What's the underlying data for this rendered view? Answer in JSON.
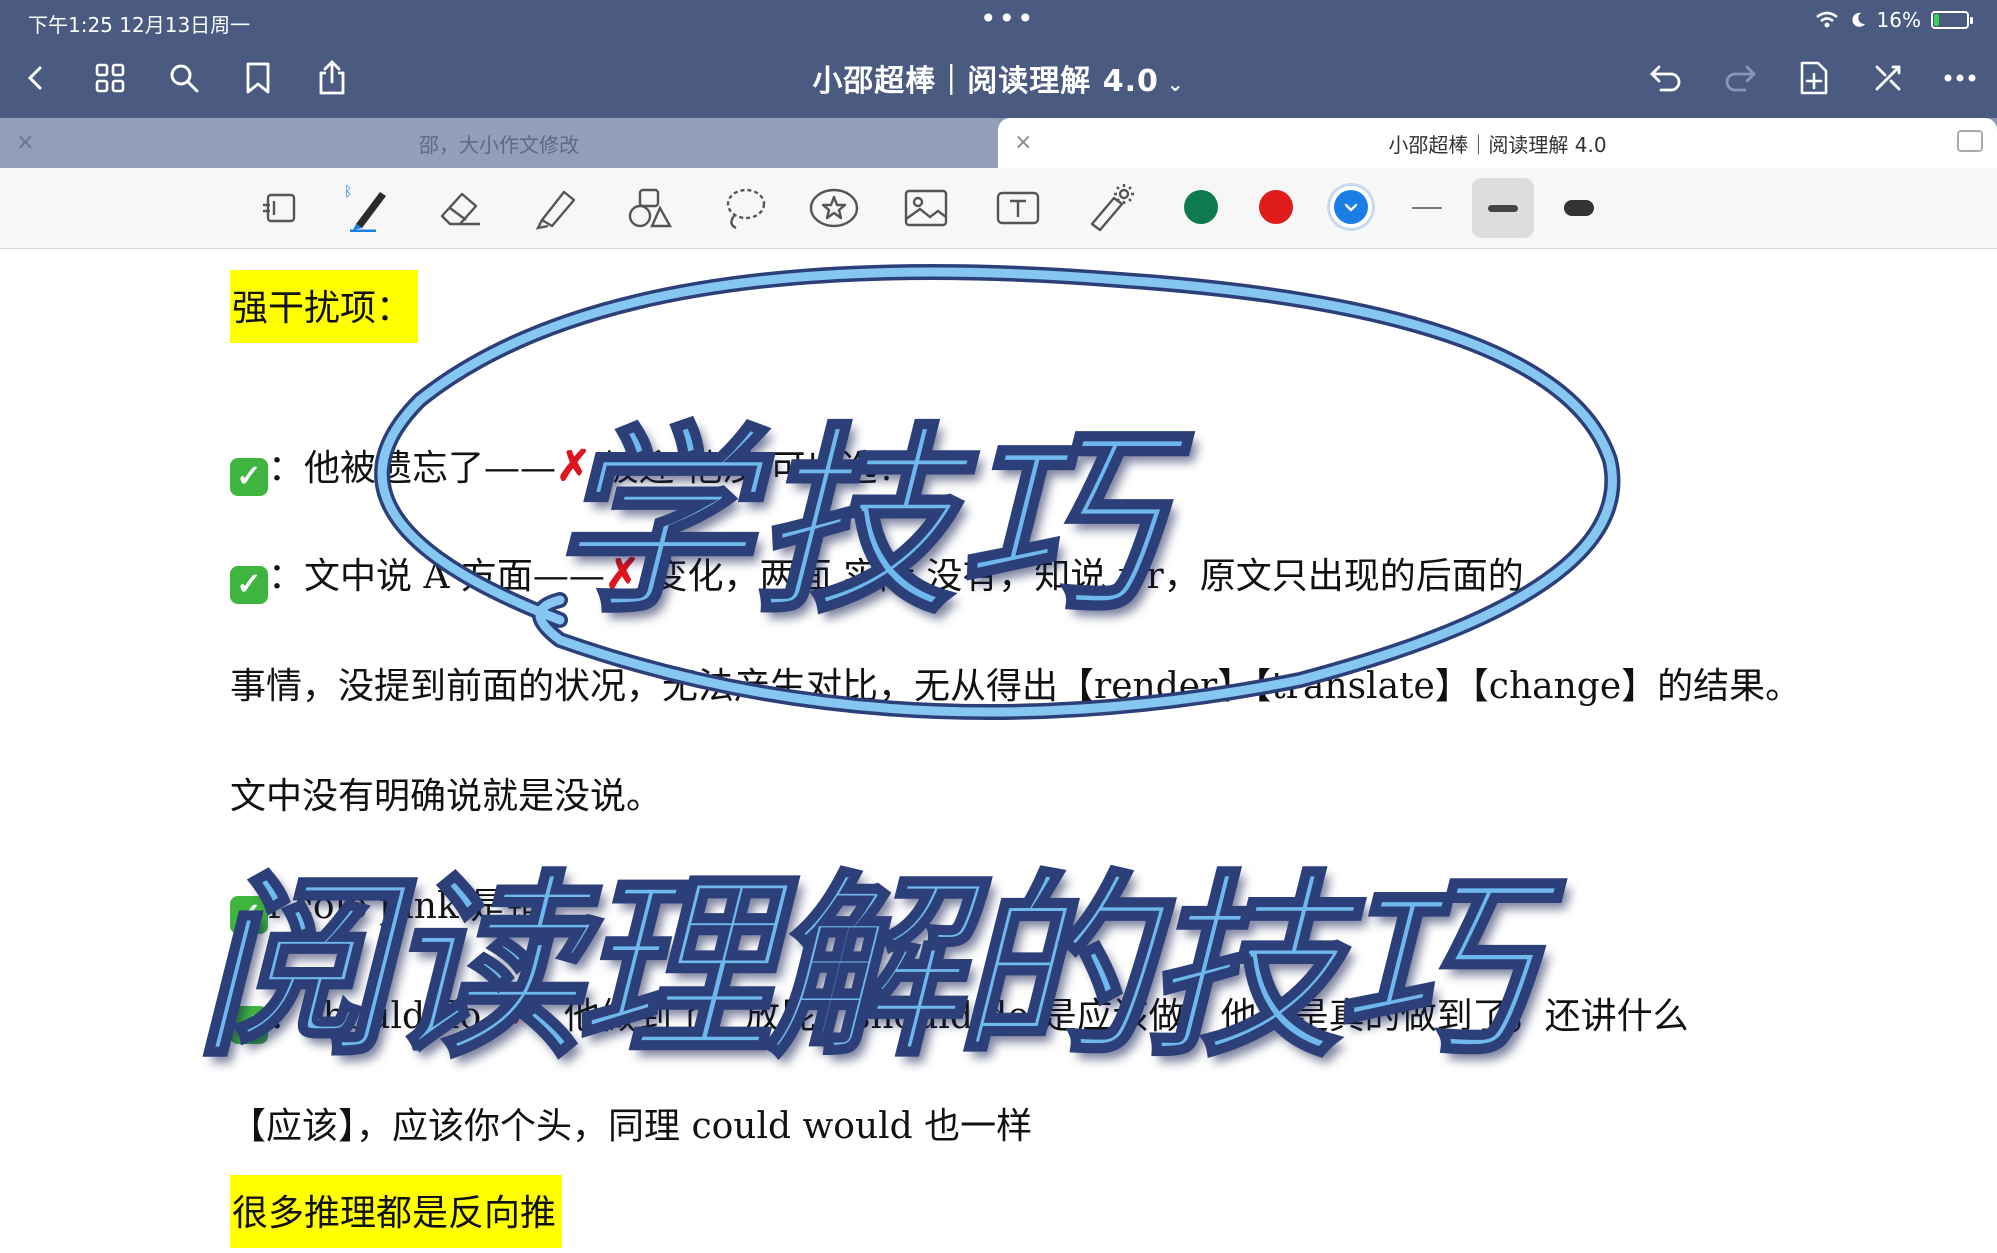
{
  "status_bar": {
    "time_date": "下午1:25   12月13日周一",
    "battery_percent": "16%",
    "battery_level": 0.16,
    "icons": [
      "wifi-icon",
      "moon-icon",
      "battery-charging-icon"
    ],
    "multitask_dots": "•••"
  },
  "nav": {
    "title": "小邵超棒｜阅读理解 4.0",
    "title_caret": "⌄",
    "left_icons": [
      "back-icon",
      "grid-icon",
      "search-icon",
      "bookmark-icon",
      "share-icon"
    ],
    "right_icons": [
      "undo-icon",
      "redo-icon",
      "add-page-icon",
      "close-cross-icon",
      "more-icon"
    ]
  },
  "tabs": [
    {
      "label": "邵，大小作文修改",
      "close": "×"
    },
    {
      "label": "小邵超棒｜阅读理解 4.0",
      "close": "×",
      "active": true
    }
  ],
  "toolbar": {
    "tools": [
      "page-view-icon",
      "pen-icon",
      "eraser-icon",
      "highlighter-icon",
      "shapes-icon",
      "lasso-icon",
      "sticker-icon",
      "image-icon",
      "text-box-icon",
      "laser-pointer-icon"
    ],
    "colors": [
      "#0e7a4f",
      "#e01b1b",
      "#1a7ee6"
    ],
    "selected_color_index": 2,
    "stroke_widths": [
      "thin",
      "medium",
      "thick"
    ],
    "selected_width_index": 1
  },
  "document": {
    "heading1": "强干扰项：",
    "line1": "：他被遗忘了——✗ 被迎 他没 可以选！",
    "line2_a": "：文中说 A 方面——✗ 变化，两面 实际 没有，知说 r r，原文只出现的后面的",
    "line2_b": "事情，没提到前面的状况，无法产生对比，无从得出【render】【translate】【change】的结果。",
    "line3": "文中没有明确说就是没说。",
    "line4": "f colo pink 是错",
    "line5": "：should do ✗：他做到了，放屁，should do 是应该做，他要是真的做到了，还讲什么",
    "line6": "【应该】，应该你个头，同理  could   would  也一样",
    "heading2": "很多推理都是反向推"
  },
  "overlay": {
    "title_top": "学技巧",
    "title_bottom": "阅读理解的技巧"
  }
}
